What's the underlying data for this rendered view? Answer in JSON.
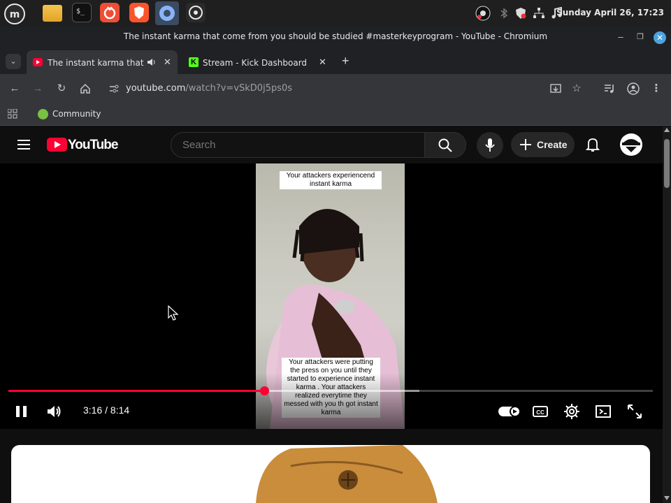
{
  "os": {
    "clock": "Sunday April 26, 17:23",
    "launcher_icons": [
      "mint-menu-icon",
      "files-icon",
      "terminal-icon",
      "app-store-icon",
      "brave-icon",
      "chromium-icon",
      "obs-icon"
    ]
  },
  "browser": {
    "window_title": "The instant karma that come from you should be studied #masterkeyprogram - YouTube - Chromium",
    "tabs": [
      {
        "label": "The instant karma that co",
        "active": true
      },
      {
        "label": "Stream - Kick Dashboard",
        "active": false
      }
    ],
    "new_tab": "+",
    "url_host": "youtube.com",
    "url_path": "/watch?v=vSkD0j5ps0s",
    "bookmarks": [
      {
        "label": "Community"
      }
    ]
  },
  "youtube": {
    "logo_text": "YouTube",
    "search_placeholder": "Search",
    "create_label": "Create",
    "player": {
      "current_time": "3:16",
      "duration": "8:14",
      "time_display": "3:16 / 8:14",
      "progress_fraction": 0.397,
      "buffered_fraction": 0.638,
      "captions": [
        "Your attackers experiencend instant karma",
        "Your attackers were putting the press on you until they started to experience instant karma . Your attackers realized everytime they messed with you th got instant karma"
      ]
    }
  },
  "colors": {
    "accent_red": "#ff0033",
    "yt_bg": "#0f0f0f",
    "chrome_bg": "#202124",
    "toolbar_bg": "#35363a"
  }
}
